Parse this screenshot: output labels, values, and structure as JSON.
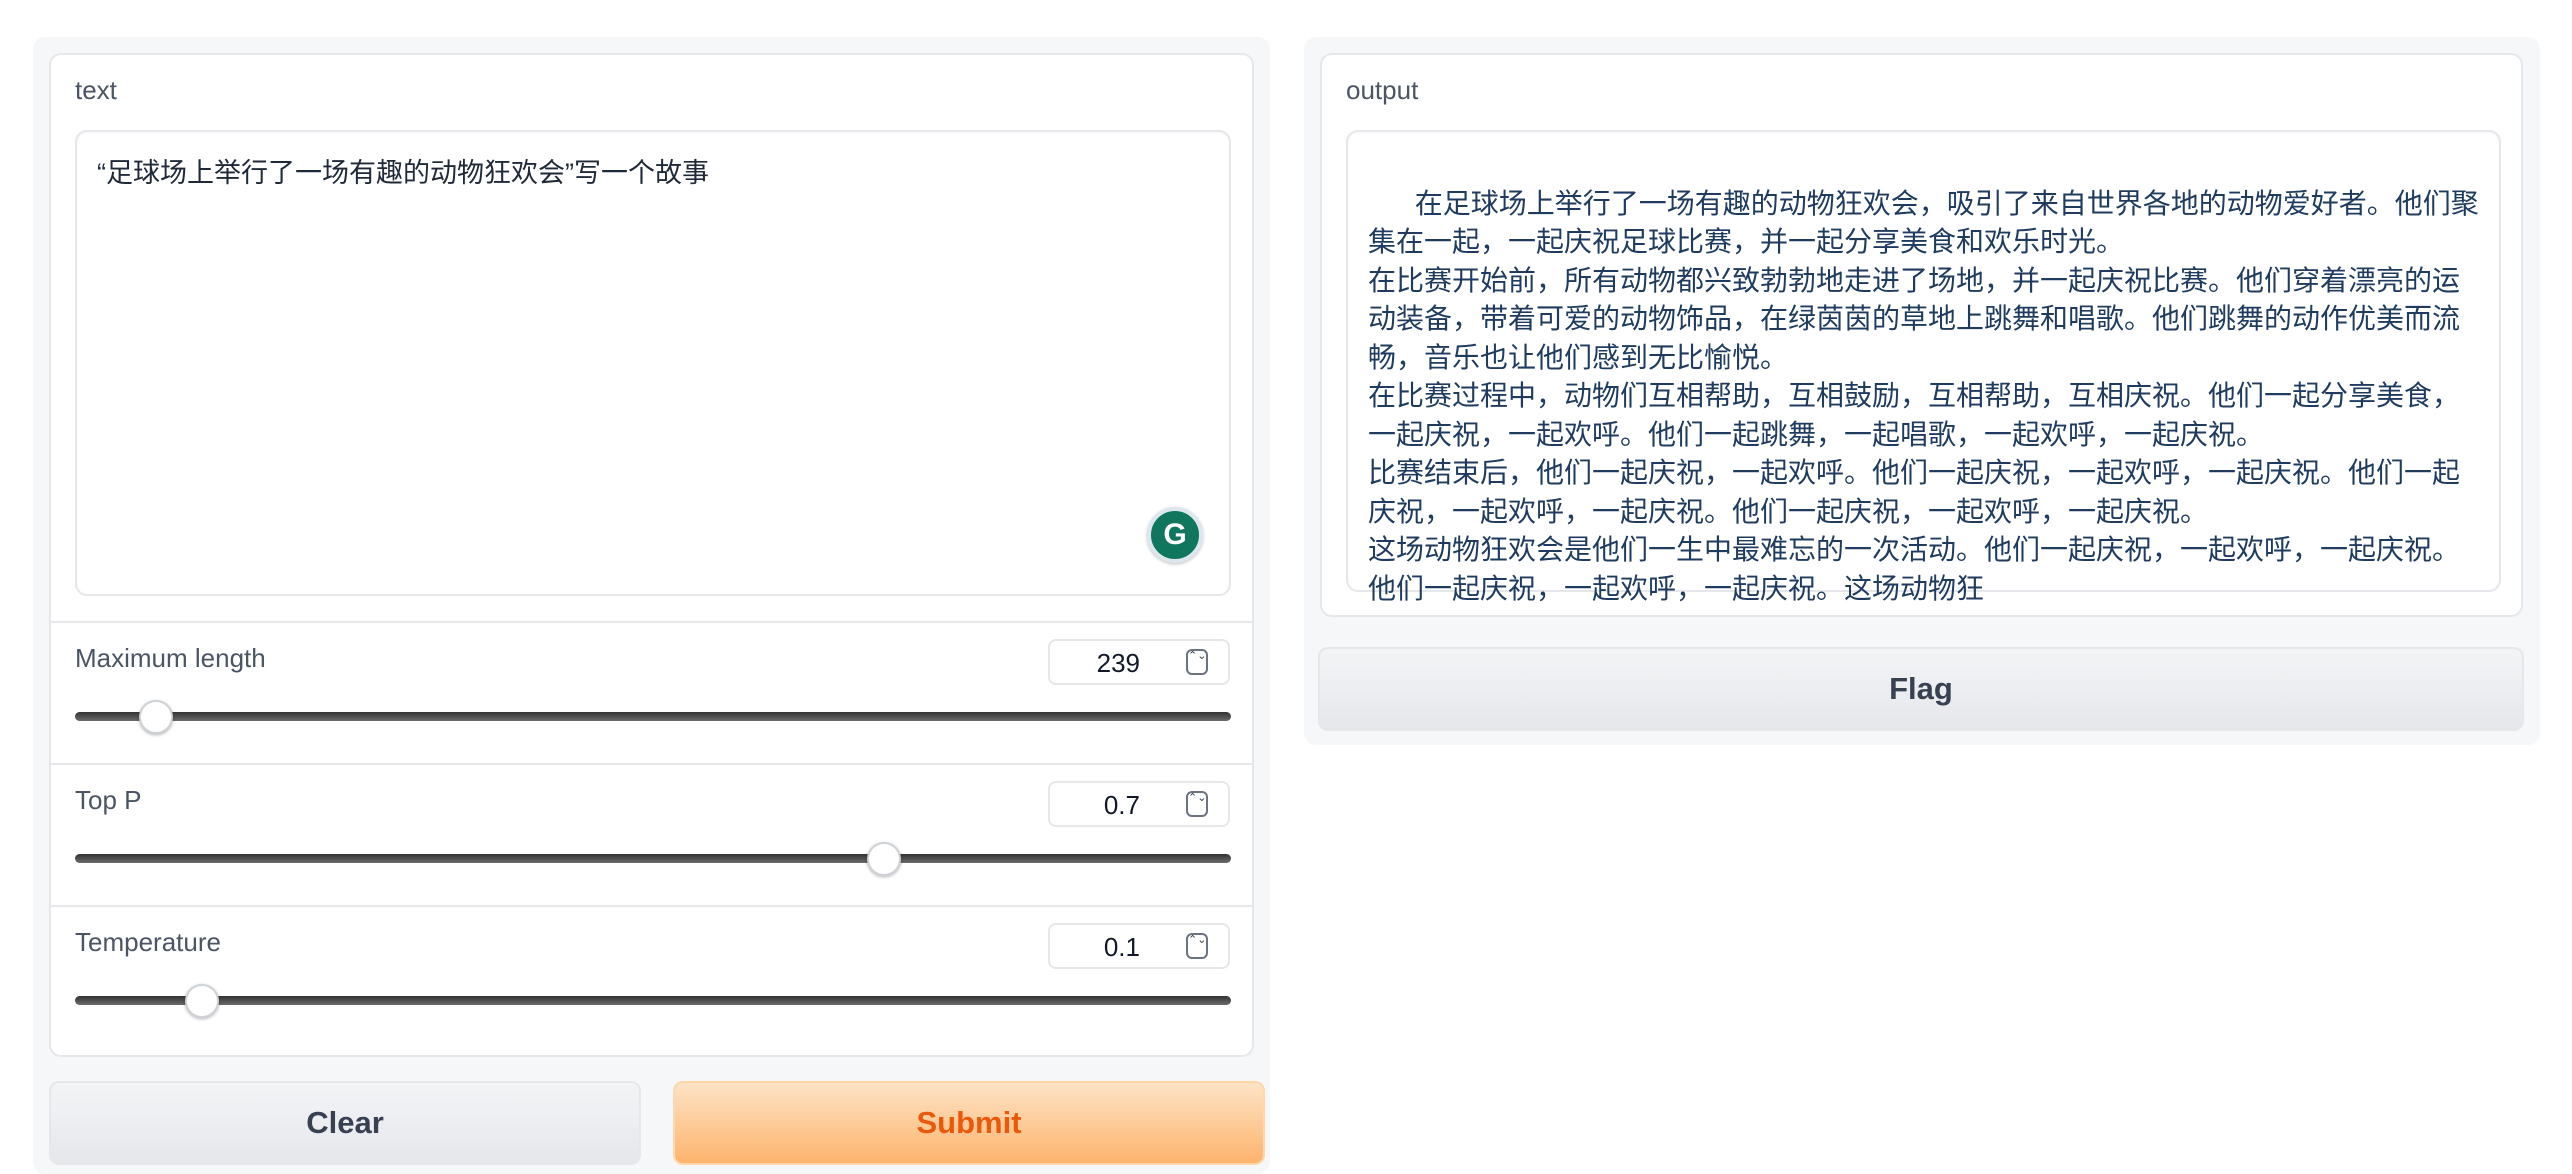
{
  "input": {
    "label": "text",
    "value": "“足球场上举行了一场有趣的动物狂欢会”写一个故事",
    "assistant_icon": "grammarly-icon",
    "assistant_glyph": "G"
  },
  "sliders": [
    {
      "label": "Maximum length",
      "value": "239",
      "fraction": 0.07
    },
    {
      "label": "Top P",
      "value": "0.7",
      "fraction": 0.7
    },
    {
      "label": "Temperature",
      "value": "0.1",
      "fraction": 0.11
    }
  ],
  "spinner_glyph": "⌃⌄",
  "buttons": {
    "clear": "Clear",
    "submit": "Submit",
    "flag": "Flag"
  },
  "output": {
    "label": "output",
    "value": "在足球场上举行了一场有趣的动物狂欢会，吸引了来自世界各地的动物爱好者。他们聚集在一起，一起庆祝足球比赛，并一起分享美食和欢乐时光。\n在比赛开始前，所有动物都兴致勃勃地走进了场地，并一起庆祝比赛。他们穿着漂亮的运动装备，带着可爱的动物饰品，在绿茵茵的草地上跳舞和唱歌。他们跳舞的动作优美而流畅，音乐也让他们感到无比愉悦。\n在比赛过程中，动物们互相帮助，互相鼓励，互相帮助，互相庆祝。他们一起分享美食，一起庆祝，一起欢呼。他们一起跳舞，一起唱歌，一起欢呼，一起庆祝。\n比赛结束后，他们一起庆祝，一起欢呼。他们一起庆祝，一起欢呼，一起庆祝。他们一起庆祝，一起欢呼，一起庆祝。他们一起庆祝，一起欢呼，一起庆祝。\n这场动物狂欢会是他们一生中最难忘的一次活动。他们一起庆祝，一起欢呼，一起庆祝。他们一起庆祝，一起欢呼，一起庆祝。这场动物狂"
  },
  "colors": {
    "primary_button_text": "#ea580c",
    "primary_button_bg": "#fdb46d",
    "assistant_icon_bg": "#11765e"
  }
}
